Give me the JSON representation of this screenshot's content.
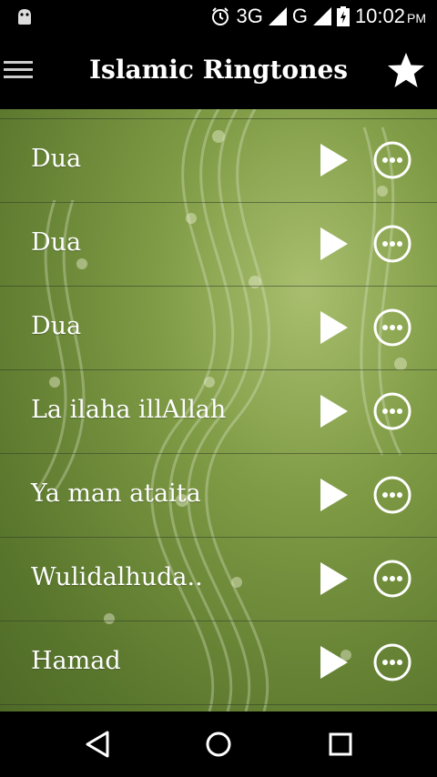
{
  "status_bar": {
    "network1": "3G",
    "network2": "G",
    "time": "10:02",
    "ampm": "PM",
    "icons": [
      "android-icon",
      "alarm-icon",
      "signal-icon",
      "signal-icon",
      "battery-icon"
    ]
  },
  "app_bar": {
    "title": "Islamic Ringtones",
    "menu_icon": "hamburger-menu-icon",
    "favorite_icon": "star-icon"
  },
  "ringtones": [
    {
      "label": "Dua"
    },
    {
      "label": "Dua"
    },
    {
      "label": "Dua"
    },
    {
      "label": "La ilaha illAllah"
    },
    {
      "label": "Ya man ataita"
    },
    {
      "label": "Wulidalhuda.."
    },
    {
      "label": "Hamad"
    }
  ],
  "row_icons": {
    "play": "play-icon",
    "more": "more-options-icon"
  },
  "nav_bar": {
    "icons": [
      "back-icon",
      "home-icon",
      "recents-icon"
    ]
  },
  "colors": {
    "background_green": "#7f9b45",
    "bar_black": "#000000",
    "text": "#ffffff"
  }
}
